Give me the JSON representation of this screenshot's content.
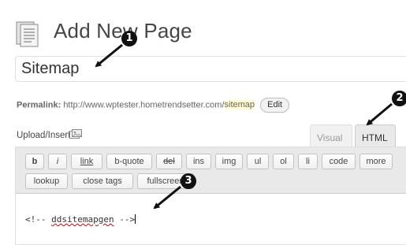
{
  "header": {
    "title": "Add New Page"
  },
  "title_field": {
    "value": "Sitemap"
  },
  "permalink": {
    "label": "Permalink:",
    "base_url": "http://www.wptester.hometrendsetter.com/",
    "slug": "sitemap",
    "edit_label": "Edit"
  },
  "upload": {
    "label": "Upload/Insert",
    "icon": "media-icon"
  },
  "tabs": {
    "visual": "Visual",
    "html": "HTML",
    "active": "HTML"
  },
  "quicktags": [
    "b",
    "i",
    "link",
    "b-quote",
    "del",
    "ins",
    "img",
    "ul",
    "ol",
    "li",
    "code",
    "more",
    "lookup",
    "close tags",
    "fullscreen"
  ],
  "editor": {
    "content_prefix": "<!-- ",
    "content_word": "ddsitemapgen",
    "content_suffix": " -->"
  },
  "callouts": [
    "1",
    "2",
    "3"
  ],
  "colors": {
    "slug_highlight": "#fffbcc",
    "callout": "#111111",
    "spellcheck": "#d40000"
  }
}
